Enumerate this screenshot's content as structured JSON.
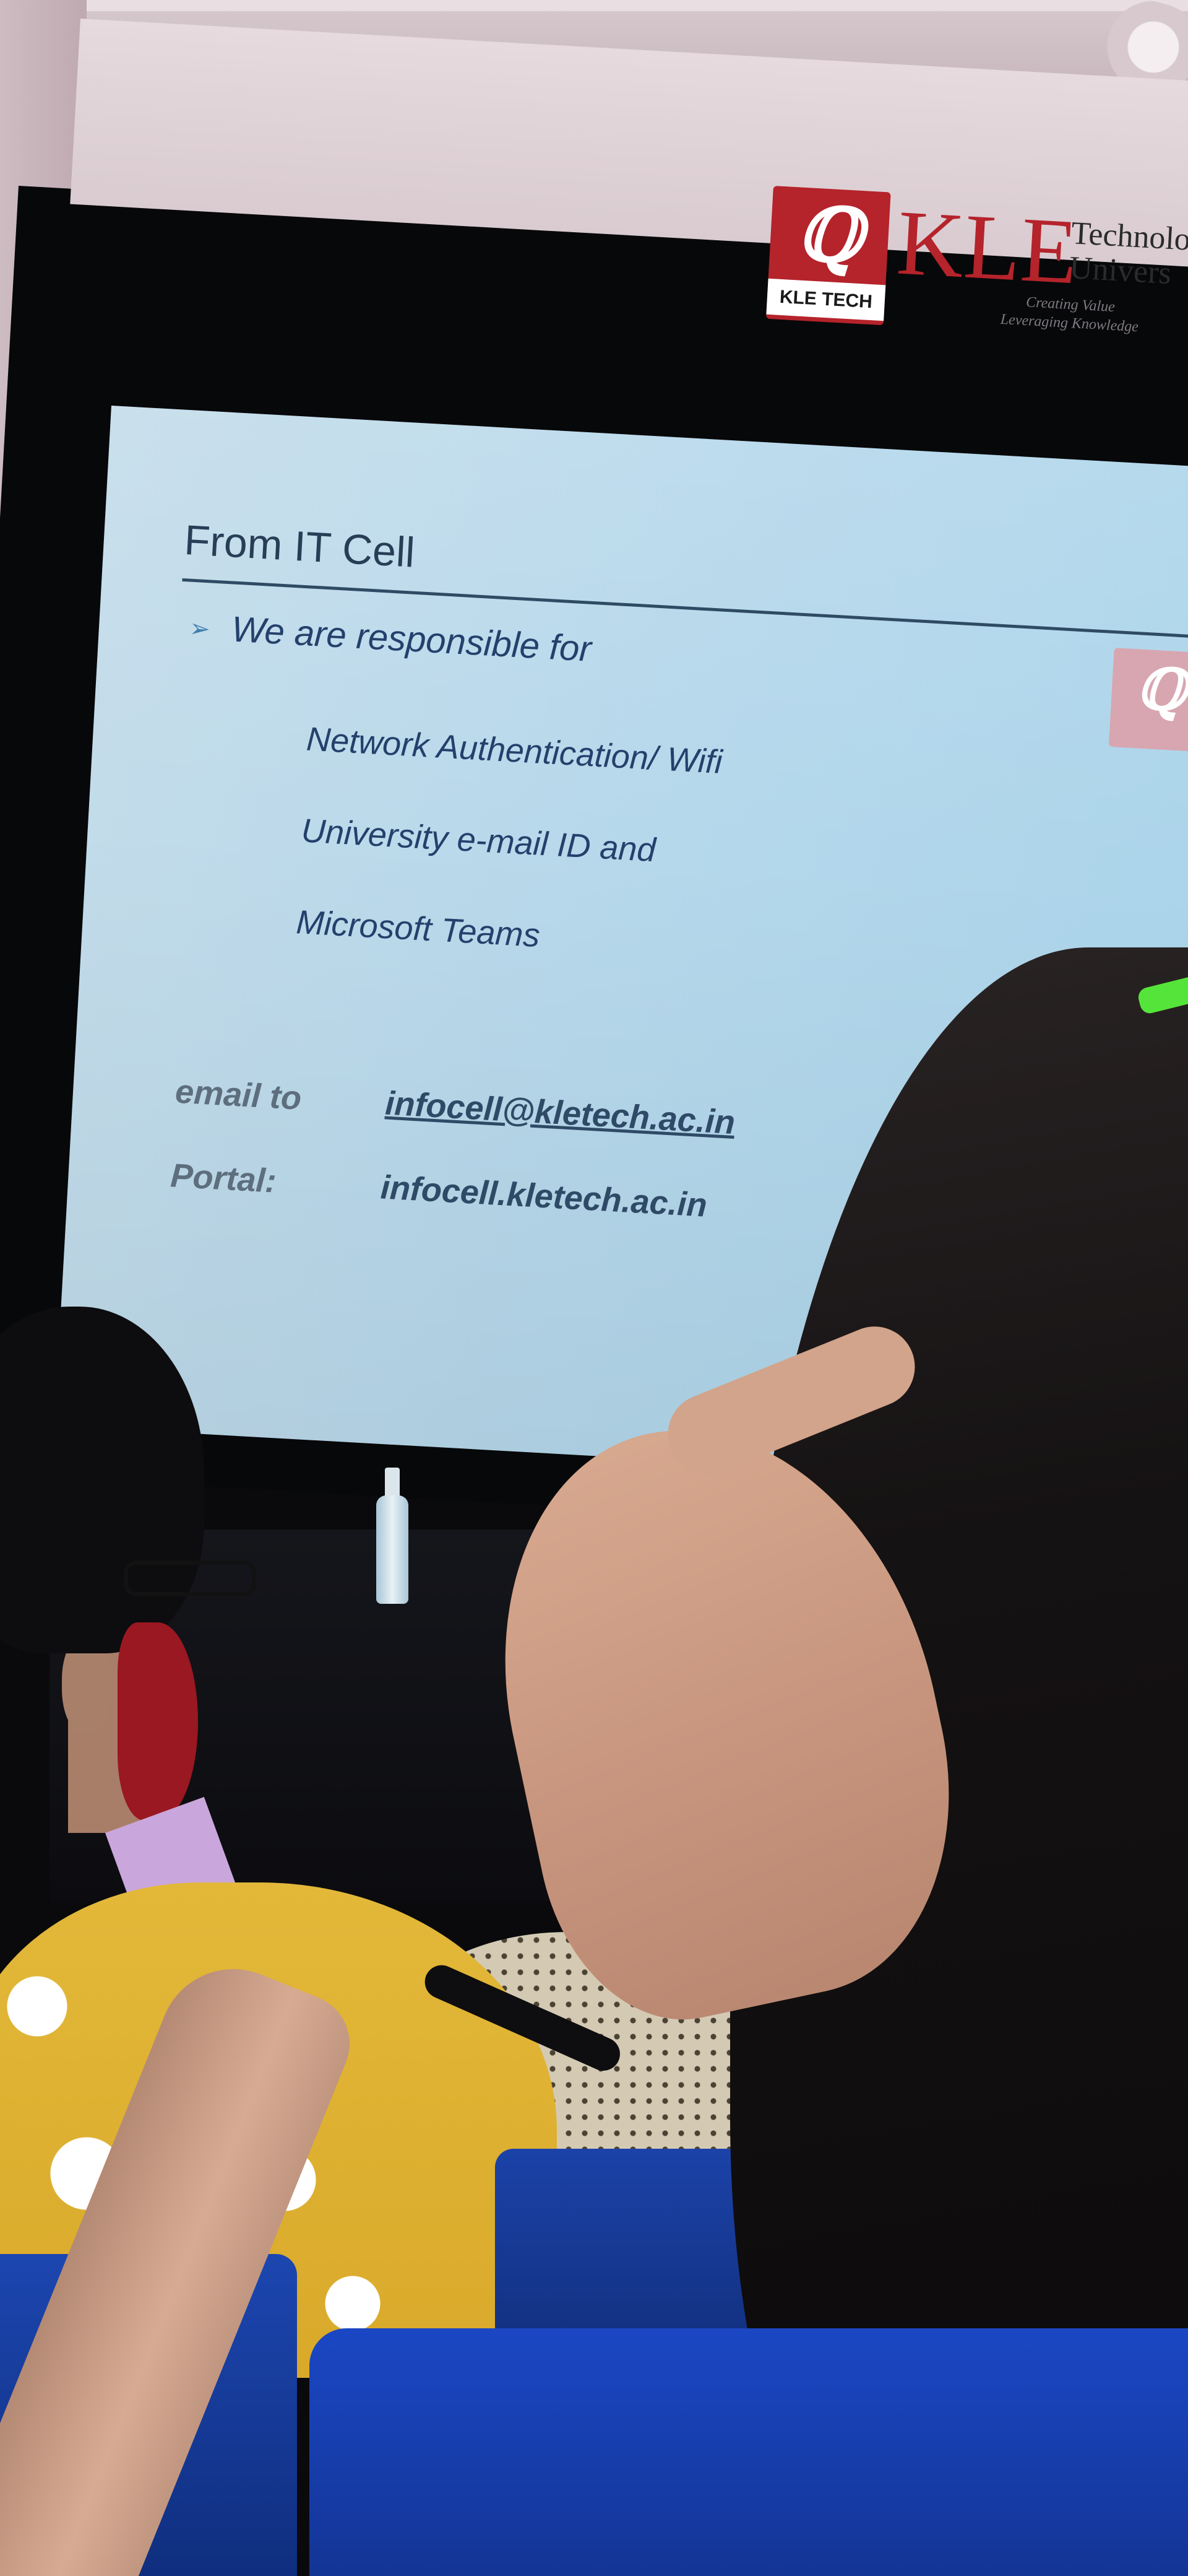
{
  "banner": {
    "logo_caption": "KLE TECH",
    "brand": "KLE",
    "brand_side_line1": "Technolog",
    "brand_side_line2": "Univers",
    "tagline_line1": "Creating Value",
    "tagline_line2": "Leveraging Knowledge"
  },
  "slide": {
    "title": "From IT Cell",
    "bullet": "We are responsible for",
    "items": [
      "Network Authentication/ Wifi",
      "University e-mail ID and",
      "Microsoft Teams"
    ],
    "email_label": "email to",
    "email_value": "infocell@kletech.ac.in",
    "portal_label": "Portal:",
    "portal_value": "infocell.kletech.ac.in"
  },
  "icons": {
    "logo": "kle-tech-q-logo-icon",
    "bullet": "arrow-bullet-icon"
  },
  "colors": {
    "brand_red": "#b5232b",
    "slide_background": "#b6d8eb",
    "slide_text": "#24406c",
    "seat_blue": "#1b47c4",
    "hair_clip_green": "#55e53a"
  }
}
